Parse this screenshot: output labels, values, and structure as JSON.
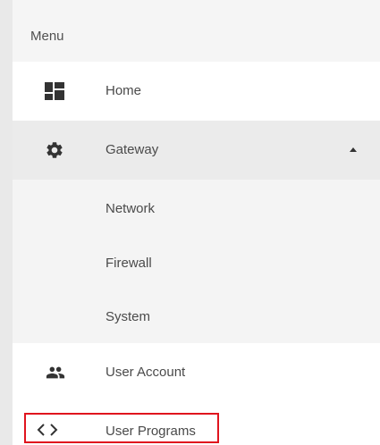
{
  "menu": {
    "title": "Menu",
    "items": [
      {
        "label": "Home",
        "icon": "dashboard-icon"
      },
      {
        "label": "Gateway",
        "icon": "gear-icon",
        "expanded": true
      },
      {
        "label": "User Account",
        "icon": "people-icon"
      },
      {
        "label": "User Programs",
        "icon": "code-icon"
      }
    ],
    "gateway_subitems": [
      {
        "label": "Network"
      },
      {
        "label": "Firewall"
      },
      {
        "label": "System"
      }
    ]
  },
  "colors": {
    "accent": "#2a8a8a",
    "highlight": "#e0141e",
    "icon": "#333333"
  }
}
